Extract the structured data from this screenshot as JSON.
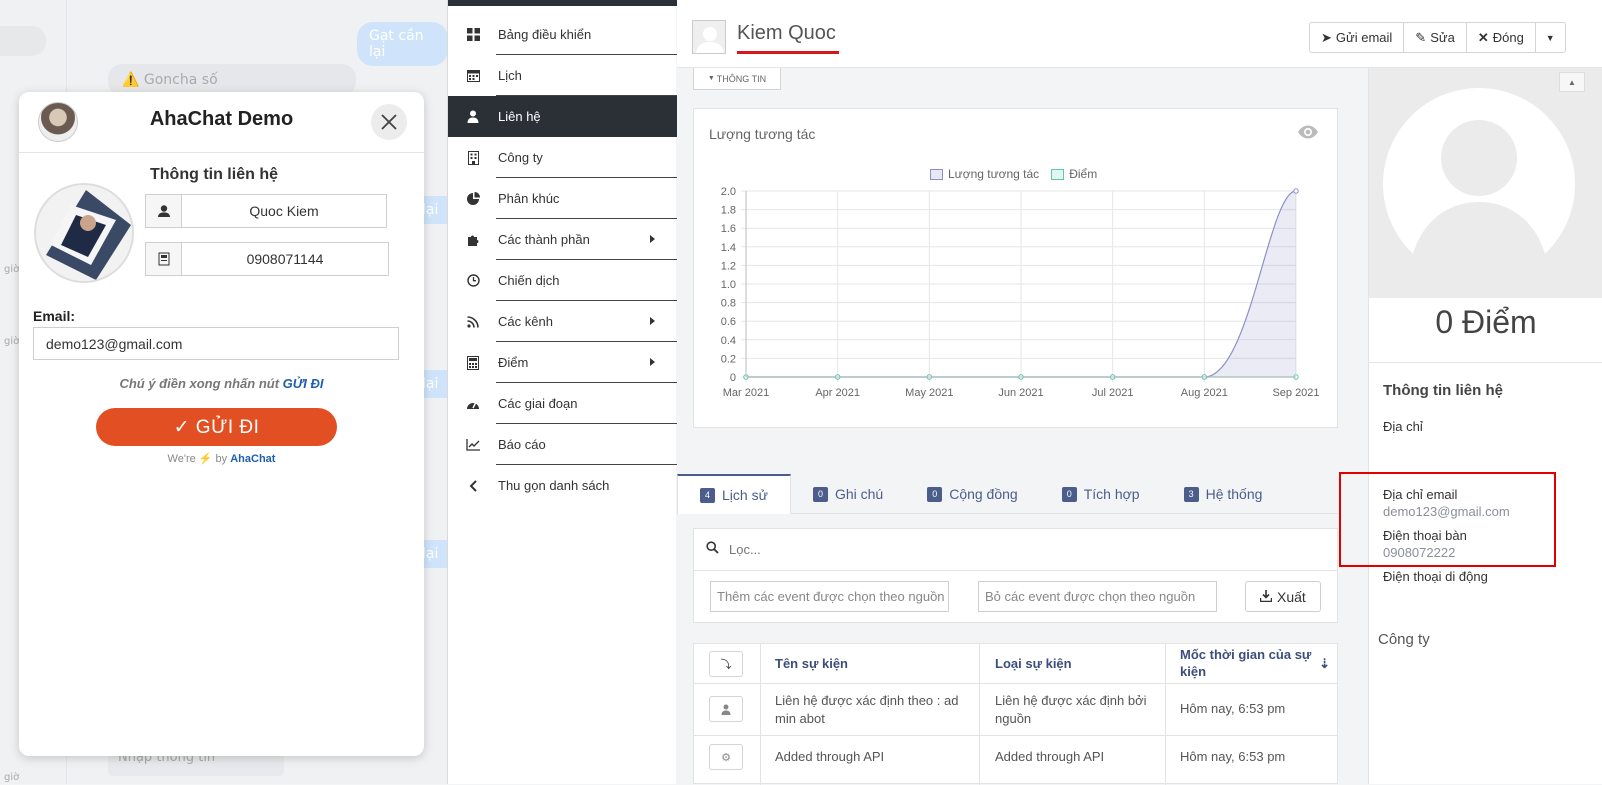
{
  "chat_bg": {
    "bubbles_right": [
      "Gạt cần lại",
      "lại",
      "lại",
      "lại"
    ],
    "bubble_left_top": "⚠️ Goncha số",
    "input_placeholder": "Nhập thông tin",
    "side_labels": [
      "giờ",
      "giờ",
      "giờ"
    ]
  },
  "popup": {
    "title": "AhaChat Demo",
    "section_title": "Thông tin liên hệ",
    "name_value": "Quoc Kiem",
    "phone_value": "0908071144",
    "email_label": "Email:",
    "email_value": "demo123@gmail.com",
    "note_text": "Chú ý điền xong nhấn nút ",
    "note_highlight": "GỬI ĐI",
    "send_button": "✓ GỬI ĐI",
    "brand_prefix": "We're ⚡ by ",
    "brand_name": "AhaChat"
  },
  "menu": {
    "items": [
      {
        "label": "Bảng điều khiển",
        "icon": "dashboard-icon"
      },
      {
        "label": "Lịch",
        "icon": "calendar-icon"
      },
      {
        "label": "Liên hệ",
        "icon": "user-icon"
      },
      {
        "label": "Công ty",
        "icon": "building-icon"
      },
      {
        "label": "Phân khúc",
        "icon": "pie-chart-icon"
      },
      {
        "label": "Các thành phần",
        "icon": "puzzle-icon"
      },
      {
        "label": "Chiến dịch",
        "icon": "clock-icon"
      },
      {
        "label": "Các kênh",
        "icon": "rss-icon"
      },
      {
        "label": "Điểm",
        "icon": "calculator-icon"
      },
      {
        "label": "Các giai đoạn",
        "icon": "tachometer-icon"
      },
      {
        "label": "Báo cáo",
        "icon": "line-chart-icon"
      },
      {
        "label": "Thu gọn danh sách",
        "icon": "chevron-left-icon"
      }
    ]
  },
  "header": {
    "contact_name": "Kiem Quoc",
    "buttons": {
      "send_email": "Gửi email",
      "edit": "Sửa",
      "close": "Đóng"
    }
  },
  "info_tab": "THÔNG TIN",
  "chart_title": "Lượng tương tác",
  "chart_data": {
    "type": "line",
    "x": [
      "Mar 2021",
      "Apr 2021",
      "May 2021",
      "Jun 2021",
      "Jul 2021",
      "Aug 2021",
      "Sep 2021"
    ],
    "series": [
      {
        "name": "Lượng tương tác",
        "values": [
          0,
          0,
          0,
          0,
          0,
          0,
          2
        ]
      },
      {
        "name": "Điểm",
        "values": [
          0,
          0,
          0,
          0,
          0,
          0,
          0
        ]
      }
    ],
    "ylim": [
      0,
      2
    ],
    "yticks": [
      "0",
      "0.2",
      "0.4",
      "0.6",
      "0.8",
      "1.0",
      "1.2",
      "1.4",
      "1.6",
      "1.8",
      "2.0"
    ],
    "legend_position": "top",
    "grid": true
  },
  "tabs": [
    {
      "count": "4",
      "label": "Lịch sử"
    },
    {
      "count": "0",
      "label": "Ghi chú"
    },
    {
      "count": "0",
      "label": "Cộng đồng"
    },
    {
      "count": "0",
      "label": "Tích hợp"
    },
    {
      "count": "3",
      "label": "Hệ thống"
    }
  ],
  "filter": {
    "placeholder": "Lọc...",
    "include_placeholder": "Thêm các event được chọn theo nguồn",
    "exclude_placeholder": "Bỏ các event được chọn theo nguồn",
    "export_button": "Xuất"
  },
  "events_table": {
    "headers": [
      "Tên sự kiện",
      "Loại sự kiện",
      "Mốc thời gian của sự kiện"
    ],
    "rows": [
      {
        "name": "Liên hệ được xác định theo : ad min abot",
        "type": "Liên hệ được xác định bởi nguồn",
        "time": "Hôm nay, 6:53 pm"
      },
      {
        "name": "Added through API",
        "type": "Added through API",
        "time": "Hôm nay, 6:53 pm"
      }
    ]
  },
  "right_panel": {
    "score": "0 Điểm",
    "section_title": "Thông tin liên hệ",
    "address_label": "Địa chỉ",
    "email_label": "Địa chỉ email",
    "email_value": "demo123@gmail.com",
    "phone_label": "Điện thoại bàn",
    "phone_value": "0908072222",
    "mobile_label": "Điện thoại di động",
    "company_label": "Công ty"
  },
  "colors": {
    "accent": "#4b5d8a",
    "send_button": "#e24f22",
    "highlight_box": "#e00000",
    "menu_active": "#2b3037"
  }
}
